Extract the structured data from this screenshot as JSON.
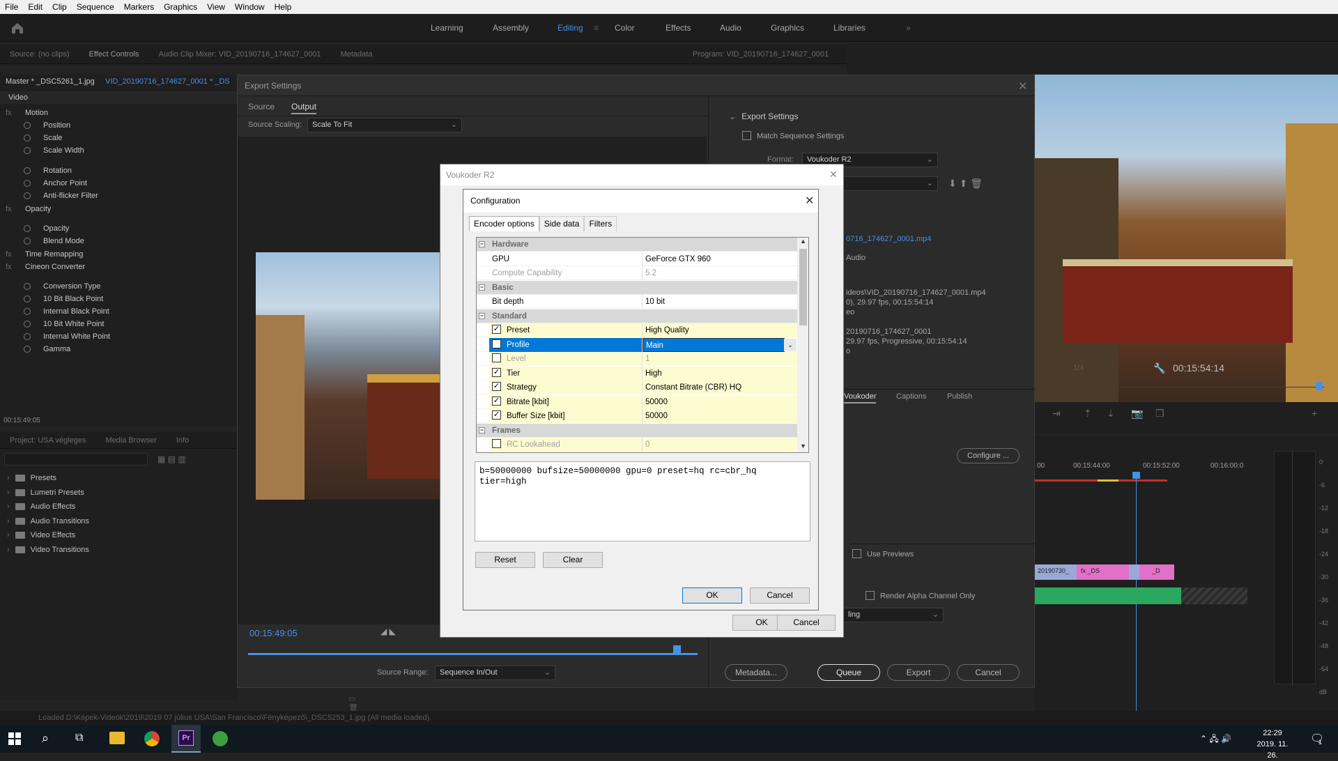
{
  "menubar": {
    "items": [
      "File",
      "Edit",
      "Clip",
      "Sequence",
      "Markers",
      "Graphics",
      "View",
      "Window",
      "Help"
    ]
  },
  "workspaces": {
    "items": [
      "Learning",
      "Assembly",
      "Editing",
      "Color",
      "Effects",
      "Audio",
      "Graphics",
      "Libraries"
    ],
    "active": "Editing",
    "more": "»"
  },
  "source_panel": {
    "tabs": [
      "Source: (no clips)",
      "Effect Controls",
      "Audio Clip Mixer: VID_20190716_174627_0001",
      "Metadata"
    ]
  },
  "program_panel": {
    "title": "Program: VID_20190716_174627_0001",
    "timecode": "00:15:54:14",
    "zoom": "1/4"
  },
  "effect_controls": {
    "master": "Master * _DSC5261_1.jpg",
    "sequence": "VID_20190716_174627_0001 * _DS",
    "section": "Video",
    "items": [
      "Motion",
      "Position",
      "Scale",
      "Scale Width",
      "Rotation",
      "Anchor Point",
      "Anti-flicker Filter",
      "Opacity",
      "Opacity",
      "Blend Mode",
      "Time Remapping",
      "Cineon Converter",
      "Conversion Type",
      "10 Bit Black Point",
      "Internal Black Point",
      "10 Bit White Point",
      "Internal White Point",
      "Gamma"
    ],
    "timecode": "00:15:49:05"
  },
  "project_panel": {
    "tabs": [
      "Project: USA végleges",
      "Media Browser",
      "Info"
    ],
    "folders": [
      "Presets",
      "Lumetri Presets",
      "Audio Effects",
      "Audio Transitions",
      "Video Effects",
      "Video Transitions"
    ]
  },
  "export_dialog": {
    "title": "Export Settings",
    "tabs": [
      "Source",
      "Output"
    ],
    "source_scaling_label": "Source Scaling:",
    "source_scaling_value": "Scale To Fit",
    "timecode": "00:15:49:05",
    "source_range_label": "Source Range:",
    "source_range_value": "Sequence In/Out",
    "settings_header": "Export Settings",
    "match_sequence": "Match Sequence Settings",
    "format_label": "Format:",
    "format_value": "Voukoder R2",
    "output_file": "0716_174627_0001.mp4",
    "audio_label": "Audio",
    "summary_line1": "ideos\\VID_20190716_174627_0001.mp4",
    "summary_line2": "0), 29.97 fps, 00:15:54:14",
    "summary_line3": "eo",
    "summary_line4": "20190716_174627_0001",
    "summary_line5": "29.97 fps, Progressive, 00:15:54:14",
    "summary_line6": "o",
    "bottom_tabs": [
      "Voukoder",
      "Captions",
      "Publish"
    ],
    "configure_button": "Configure ...",
    "use_previews": "Use Previews",
    "render_alpha": "Render Alpha Channel Only",
    "dropdown_partial": "ling",
    "buttons": {
      "metadata": "Metadata...",
      "queue": "Queue",
      "export": "Export",
      "cancel": "Cancel"
    }
  },
  "voukoder_dialog": {
    "title": "Voukoder R2",
    "ok": "OK",
    "cancel": "Cancel"
  },
  "config_dialog": {
    "title": "Configuration",
    "tabs": [
      "Encoder options",
      "Side data",
      "Filters"
    ],
    "rows": [
      {
        "type": "cat",
        "key": "Hardware"
      },
      {
        "type": "row",
        "key": "GPU",
        "value": "GeForce GTX 960"
      },
      {
        "type": "dis",
        "key": "Compute Capability",
        "value": "5.2"
      },
      {
        "type": "cat",
        "key": "Basic"
      },
      {
        "type": "row",
        "key": "Bit depth",
        "value": "10 bit"
      },
      {
        "type": "cat",
        "key": "Standard"
      },
      {
        "type": "chk",
        "key": "Preset",
        "value": "High Quality",
        "checked": true
      },
      {
        "type": "sel",
        "key": "Profile",
        "value": "Main",
        "checked": false
      },
      {
        "type": "chkdis",
        "key": "Level",
        "value": "1",
        "checked": false
      },
      {
        "type": "chk",
        "key": "Tier",
        "value": "High",
        "checked": true
      },
      {
        "type": "chk",
        "key": "Strategy",
        "value": "Constant Bitrate (CBR) HQ",
        "checked": true
      },
      {
        "type": "chk",
        "key": "Bitrate [kbit]",
        "value": "50000",
        "checked": true
      },
      {
        "type": "chk",
        "key": "Buffer Size [kbit]",
        "value": "50000",
        "checked": true
      },
      {
        "type": "cat",
        "key": "Frames"
      },
      {
        "type": "chkdis",
        "key": "RC Lookahead",
        "value": "0",
        "checked": false
      }
    ],
    "command_line1": "b=50000000 bufsize=50000000 gpu=0 preset=hq rc=cbr_hq",
    "command_line2": "tier=high",
    "reset": "Reset",
    "clear": "Clear",
    "ok": "OK",
    "cancel": "Cancel"
  },
  "timeline": {
    "times": [
      "00",
      "00:15:44:00",
      "00:15:52:00",
      "00:16:00:0"
    ],
    "meter": [
      "0",
      "-6",
      "-12",
      "-18",
      "-24",
      "-30",
      "-36",
      "-42",
      "-48",
      "-54",
      "dB"
    ],
    "clips": [
      "20190730_",
      "fx _DS",
      "_D"
    ],
    "clip_marks": [
      "fx",
      "fx"
    ]
  },
  "status_bar": {
    "text": "Loaded D:\\Képek-Videók\\2019\\2019 07 július USA\\San Francisco\\Fényképező\\_DSC5253_1.jpg (All media loaded)."
  },
  "taskbar": {
    "time": "22:29",
    "date": "2019. 11. 26.",
    "notification": "1"
  },
  "colors": {
    "accent": "#4a90e2",
    "selection": "#0078d7",
    "highlight_row": "#fdfbd0"
  }
}
